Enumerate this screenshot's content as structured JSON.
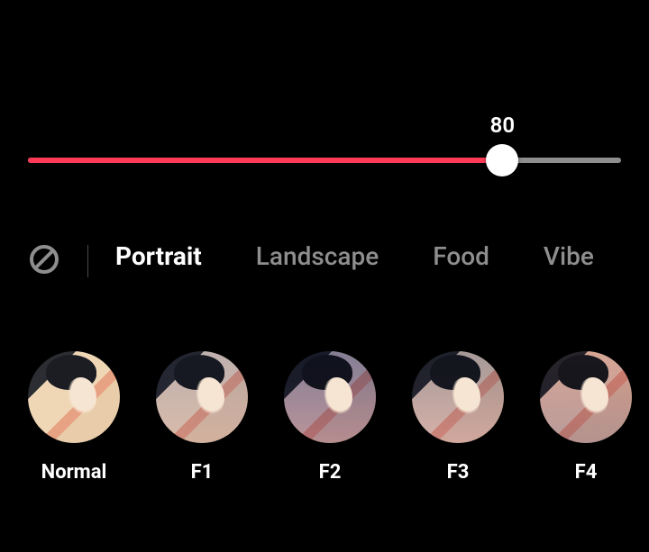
{
  "slider": {
    "value": 80,
    "min": 0,
    "max": 100,
    "display": "80"
  },
  "categories": {
    "active_index": 0,
    "items": [
      {
        "label": "Portrait"
      },
      {
        "label": "Landscape"
      },
      {
        "label": "Food"
      },
      {
        "label": "Vibe"
      }
    ]
  },
  "filters": {
    "items": [
      {
        "label": "Normal",
        "tint": "normal"
      },
      {
        "label": "F1",
        "tint": "f1"
      },
      {
        "label": "F2",
        "tint": "f2"
      },
      {
        "label": "F3",
        "tint": "f3"
      },
      {
        "label": "F4",
        "tint": "f4"
      }
    ]
  },
  "colors": {
    "accent": "#fd3b57",
    "inactive": "#8e8e8e"
  }
}
